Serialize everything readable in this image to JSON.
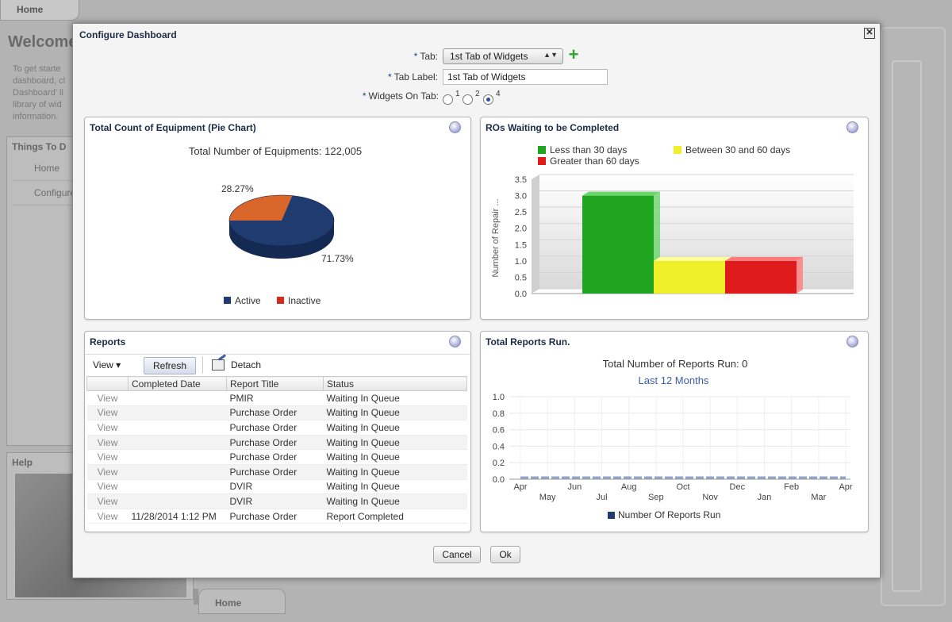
{
  "background": {
    "home_tab": "Home",
    "welcome": "Welcome",
    "intro_lines": [
      "To get starte",
      "dashboard, cl",
      "Dashboard' li",
      "library of wid",
      "information."
    ],
    "things_title": "Things To D",
    "links": [
      "Home",
      "Configure"
    ],
    "help_title": "Help",
    "bottom_tab": "Home"
  },
  "dialog": {
    "title": "Configure Dashboard",
    "close_glyph": "✕",
    "form": {
      "tab_label": "Tab:",
      "tab_value": "1st Tab of Widgets",
      "tab_label_label": "Tab Label:",
      "tab_label_value": "1st Tab of Widgets",
      "widgets_label": "Widgets On Tab:",
      "widget_options": [
        "1",
        "2",
        "4"
      ],
      "widget_selected": "4",
      "required_mark": "*",
      "add_glyph": "+",
      "dropdown_glyph": "▲▼"
    },
    "panels": {
      "pie": {
        "title": "Total Count of Equipment (Pie Chart)"
      },
      "ros": {
        "title": "ROs Waiting to be Completed"
      },
      "reports": {
        "title": "Reports",
        "view_label": "View ▾",
        "refresh_label": "Refresh",
        "detach_label": "Detach",
        "columns": [
          "",
          "Completed Date",
          "Report Title",
          "Status"
        ],
        "rows": [
          [
            "View",
            "",
            "PMIR",
            "Waiting In Queue"
          ],
          [
            "View",
            "",
            "Purchase Order",
            "Waiting In Queue"
          ],
          [
            "View",
            "",
            "Purchase Order",
            "Waiting In Queue"
          ],
          [
            "View",
            "",
            "Purchase Order",
            "Waiting In Queue"
          ],
          [
            "View",
            "",
            "Purchase Order",
            "Waiting In Queue"
          ],
          [
            "View",
            "",
            "Purchase Order",
            "Waiting In Queue"
          ],
          [
            "View",
            "",
            "DVIR",
            "Waiting In Queue"
          ],
          [
            "View",
            "",
            "DVIR",
            "Waiting In Queue"
          ],
          [
            "View",
            "11/28/2014 1:12 PM",
            "Purchase Order",
            "Report Completed"
          ]
        ]
      },
      "total_reports": {
        "title": "Total Reports Run."
      }
    },
    "buttons": {
      "cancel": "Cancel",
      "ok": "Ok"
    }
  },
  "colors": {
    "pie_active": "#1f3b70",
    "pie_inactive": "#d9662b",
    "bar_green": "#1fa51f",
    "bar_yellow": "#f0f02a",
    "bar_red": "#e01b1b"
  },
  "chart_data": [
    {
      "type": "pie",
      "title": "Total Number of Equipments: 122,005",
      "categories": [
        "Active",
        "Inactive"
      ],
      "values": [
        71.73,
        28.27
      ],
      "value_labels": [
        "71.73%",
        "28.27%"
      ],
      "legend": "bottom"
    },
    {
      "type": "bar",
      "title": "",
      "ylabel": "Number of Repair ...",
      "categories": [
        "Less than 30 days",
        "Between 30 and 60 days",
        "Greater than 60 days"
      ],
      "values": [
        3,
        1,
        1
      ],
      "ylim": [
        0,
        3.5
      ],
      "yticks": [
        "3.5",
        "3.0",
        "2.5",
        "2.0",
        "1.5",
        "1.0",
        "0.5",
        "0.0"
      ],
      "legend": "top"
    },
    {
      "type": "area",
      "title": "Total Number of Reports Run: 0",
      "subtitle": "Last 12 Months",
      "series": [
        {
          "name": "Number Of Reports Run",
          "values": [
            0,
            0,
            0,
            0,
            0,
            0,
            0,
            0,
            0,
            0,
            0,
            0,
            0
          ]
        }
      ],
      "x": [
        "Apr",
        "May",
        "Jun",
        "Jul",
        "Aug",
        "Sep",
        "Oct",
        "Nov",
        "Dec",
        "Jan",
        "Feb",
        "Mar",
        "Apr"
      ],
      "ylim": [
        0,
        1.0
      ],
      "yticks": [
        "1.0",
        "0.8",
        "0.6",
        "0.4",
        "0.2",
        "0.0"
      ],
      "legend": "bottom"
    }
  ]
}
